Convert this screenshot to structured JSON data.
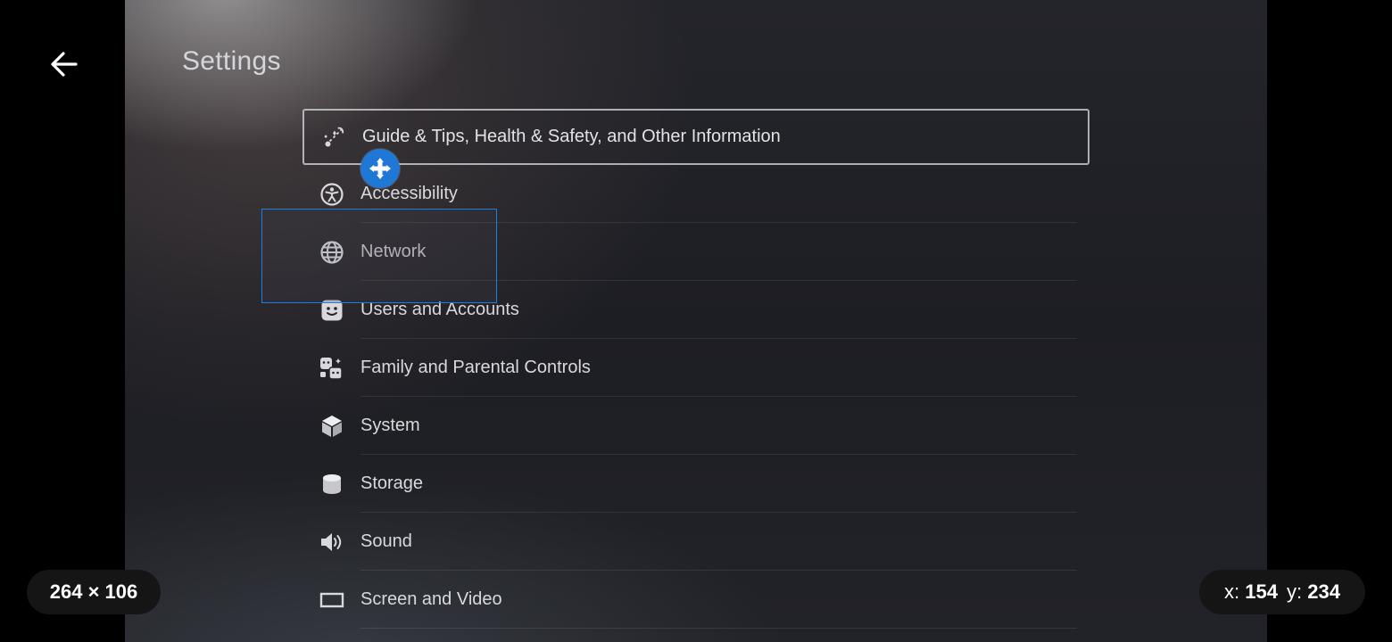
{
  "page": {
    "title": "Settings",
    "back_icon": "arrow-left-icon"
  },
  "menu": [
    {
      "label": "Guide & Tips, Health & Safety, and Other Information",
      "icon": "guide-tips-icon",
      "focused": true
    },
    {
      "label": "Accessibility",
      "icon": "accessibility-icon"
    },
    {
      "label": "Network",
      "icon": "globe-icon"
    },
    {
      "label": "Users and Accounts",
      "icon": "user-face-icon"
    },
    {
      "label": "Family and Parental Controls",
      "icon": "family-icon"
    },
    {
      "label": "System",
      "icon": "cube-icon"
    },
    {
      "label": "Storage",
      "icon": "storage-icon"
    },
    {
      "label": "Sound",
      "icon": "speaker-icon"
    },
    {
      "label": "Screen and Video",
      "icon": "screen-icon"
    }
  ],
  "overlay": {
    "selection_size": "264 × 106",
    "coords": {
      "x_label": "x:",
      "x_value": "154",
      "y_label": "y:",
      "y_value": "234"
    },
    "move_icon": "move-arrows-icon"
  },
  "colors": {
    "background": "#000000",
    "selection_border": "#1a7fe0",
    "move_handle": "#1f78d6",
    "text": "#d9d9dd"
  }
}
